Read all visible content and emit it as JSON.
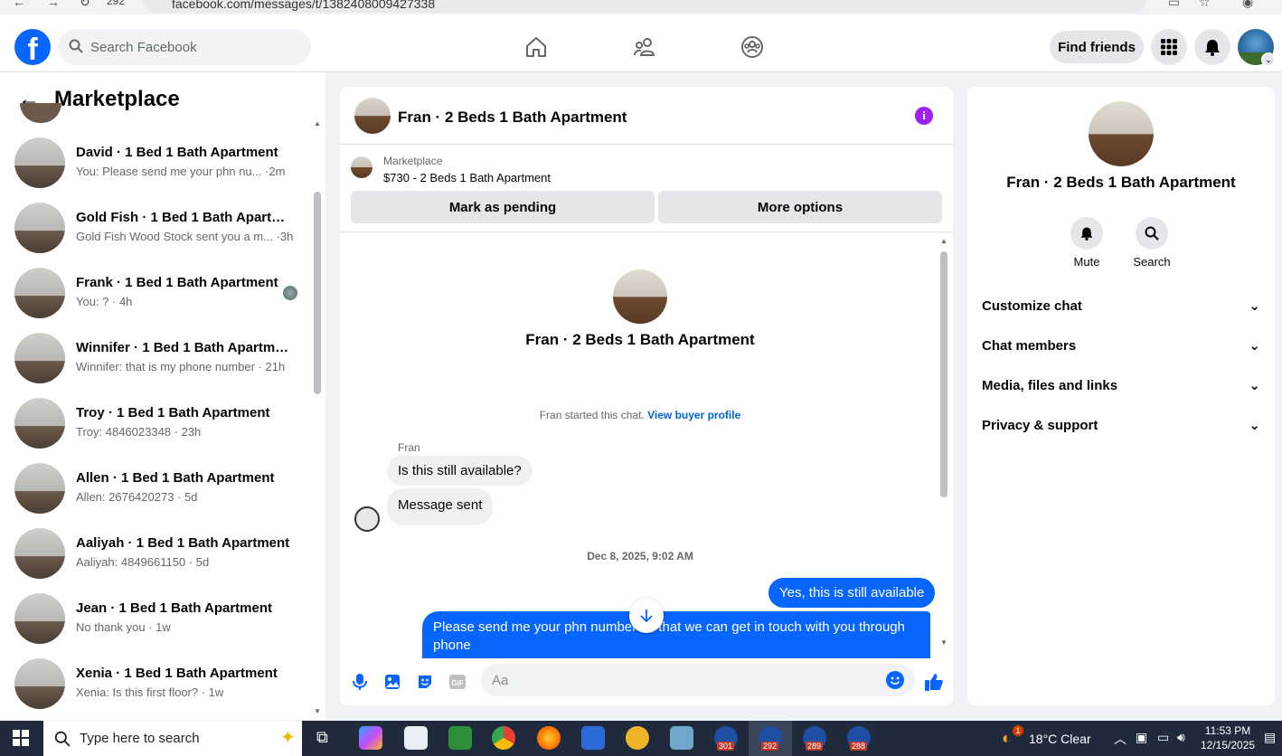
{
  "browser": {
    "url": "facebook.com/messages/t/1382408009427338",
    "tab_count": "292"
  },
  "header": {
    "search_placeholder": "Search Facebook",
    "find_friends_label": "Find friends"
  },
  "sidebar": {
    "title": "Marketplace",
    "conversations": [
      {
        "name": "David · 1 Bed 1 Bath Apartment",
        "snippet": "You: Please send me your phn nu... ·2m"
      },
      {
        "name": "Gold Fish · 1 Bed 1 Bath Apartme...",
        "snippet": "Gold Fish Wood Stock sent you a m... ·3h"
      },
      {
        "name": "Frank · 1 Bed 1 Bath Apartment",
        "snippet": "You: ? · 4h"
      },
      {
        "name": "Winnifer · 1 Bed 1 Bath Apartment",
        "snippet": "Winnifer: that is my phone number · 21h"
      },
      {
        "name": "Troy · 1 Bed 1 Bath Apartment",
        "snippet": "Troy: 4846023348 · 23h"
      },
      {
        "name": "Allen · 1 Bed 1 Bath Apartment",
        "snippet": "Allen: 2676420273 · 5d"
      },
      {
        "name": "Aaliyah · 1 Bed 1 Bath Apartment",
        "snippet": "Aaliyah: 4849661150 · 5d"
      },
      {
        "name": "Jean · 1 Bed 1 Bath Apartment",
        "snippet": "No thank you · 1w"
      },
      {
        "name": "Xenia · 1 Bed 1 Bath Apartment",
        "snippet": "Xenia: Is this first floor? · 1w"
      }
    ]
  },
  "chat": {
    "title": "Fran · 2 Beds 1 Bath Apartment",
    "marketplace_label": "Marketplace",
    "listing": "$730 - 2 Beds 1 Bath Apartment",
    "mark_pending_label": "Mark as pending",
    "more_options_label": "More options",
    "intro_title": "Fran · 2 Beds 1 Bath Apartment",
    "started_text": "Fran started this chat.",
    "view_profile_label": "View buyer profile",
    "sender_name": "Fran",
    "incoming": [
      "Is this still available?",
      "Message sent"
    ],
    "date_separator": "Dec 8, 2025, 9:02 AM",
    "outgoing": [
      "Yes, this is still available",
      "Please send me your phn number so that we can get in touch with you through phone"
    ],
    "composer_placeholder": "Aa"
  },
  "info_panel": {
    "title": "Fran · 2 Beds 1 Bath Apartment",
    "mute_label": "Mute",
    "search_label": "Search",
    "rows": [
      "Customize chat",
      "Chat members",
      "Media, files and links",
      "Privacy & support"
    ]
  },
  "taskbar": {
    "search_placeholder": "Type here to search",
    "weather": "18°C  Clear",
    "weather_badge": "1",
    "time": "11:53 PM",
    "date": "12/15/2025",
    "app_badges": [
      "301",
      "292",
      "289",
      "288"
    ]
  },
  "colors": {
    "fb_blue": "#0866ff",
    "info_purple": "#a020f0",
    "taskbar": "#1f2a3c"
  }
}
